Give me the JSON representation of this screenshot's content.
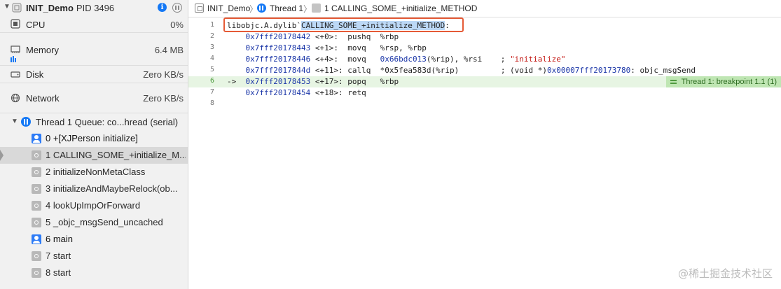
{
  "process": {
    "name": "INIT_Demo",
    "pid": "PID 3496"
  },
  "gauges": [
    {
      "label": "CPU",
      "value": "0%"
    },
    {
      "label": "Memory",
      "value": "6.4 MB"
    },
    {
      "label": "Disk",
      "value": "Zero KB/s"
    },
    {
      "label": "Network",
      "value": "Zero KB/s"
    }
  ],
  "thread": {
    "label": "Thread 1 Queue: co...hread (serial)"
  },
  "frames": [
    {
      "label": "0 +[XJPerson initialize]",
      "kind": "user"
    },
    {
      "label": "1 CALLING_SOME_+initialize_M...",
      "kind": "sys",
      "selected": true
    },
    {
      "label": "2 initializeNonMetaClass",
      "kind": "sys"
    },
    {
      "label": "3 initializeAndMaybeRelock(ob...",
      "kind": "sys"
    },
    {
      "label": "4 lookUpImpOrForward",
      "kind": "sys"
    },
    {
      "label": "5 _objc_msgSend_uncached",
      "kind": "sys"
    },
    {
      "label": "6 main",
      "kind": "user"
    },
    {
      "label": "7 start",
      "kind": "sys"
    },
    {
      "label": "8 start",
      "kind": "sys"
    }
  ],
  "jumpbar": {
    "project": "INIT_Demo",
    "thread": "Thread 1",
    "frame": "1 CALLING_SOME_+initialize_METHOD"
  },
  "disassembly": {
    "header_prefix": "libobjc.A.dylib`",
    "header_symbol": "CALLING_SOME_+initialize_METHOD",
    "header_suffix": ":",
    "lines": [
      {
        "num": "1"
      },
      {
        "num": "2",
        "addr": "0x7fff20178442",
        "offset": "<+0>:",
        "mnemonic": "pushq",
        "operands": "%rbp",
        "comment": ""
      },
      {
        "num": "3",
        "addr": "0x7fff20178443",
        "offset": "<+1>:",
        "mnemonic": "movq",
        "operands": "%rsp, %rbp",
        "comment": ""
      },
      {
        "num": "4",
        "addr": "0x7fff20178446",
        "offset": "<+4>:",
        "mnemonic": "movq",
        "operand_addr": "0x66bdc013",
        "operands": "(%rip), %rsi",
        "comment_str": "\"initialize\""
      },
      {
        "num": "5",
        "addr": "0x7fff2017844d",
        "offset": "<+11>:",
        "mnemonic": "callq",
        "operand_addr": "*0x5fea583d",
        "operands": "(%rip)",
        "comment_pre": "; (void *)",
        "comment_addr": "0x00007fff20173780",
        "comment_post": ": objc_msgSend"
      },
      {
        "num": "6",
        "addr": "0x7fff20178453",
        "offset": "<+17>:",
        "mnemonic": "popq",
        "operands": "%rbp",
        "current": true,
        "arrow": "->"
      },
      {
        "num": "7",
        "addr": "0x7fff20178454",
        "offset": "<+18>:",
        "mnemonic": "retq",
        "operands": ""
      },
      {
        "num": "8"
      }
    ],
    "breakpoint_badge": "Thread 1: breakpoint 1.1 (1)"
  },
  "watermark": "@稀土掘金技术社区"
}
